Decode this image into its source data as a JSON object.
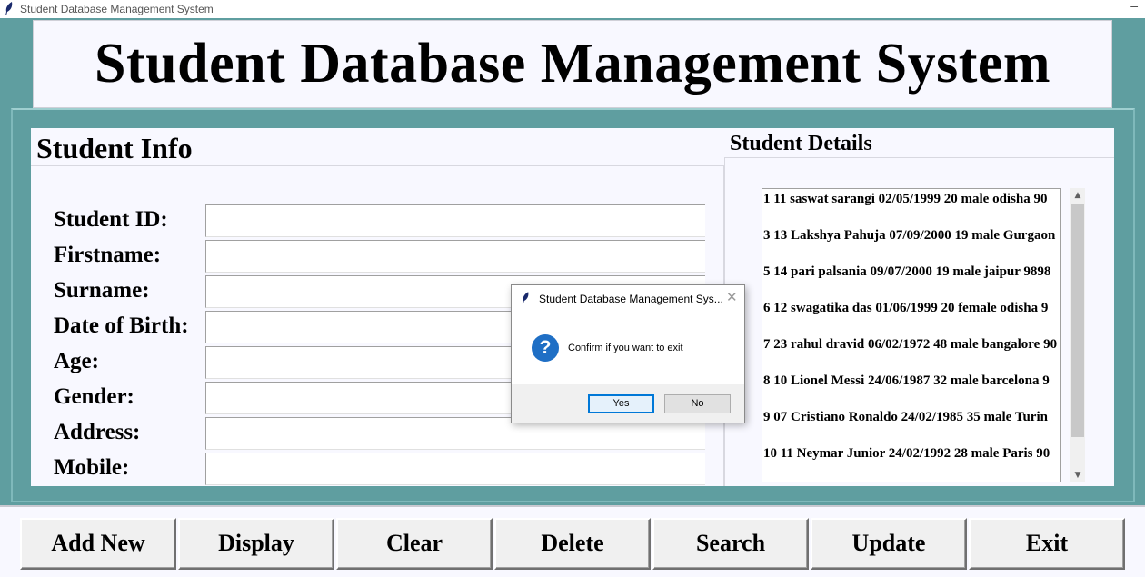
{
  "window": {
    "title": "Student Database Management System"
  },
  "header": {
    "title": "Student Database Management System"
  },
  "student_info": {
    "heading": "Student Info",
    "fields": [
      {
        "label": "Student ID:",
        "value": ""
      },
      {
        "label": "Firstname:",
        "value": ""
      },
      {
        "label": "Surname:",
        "value": ""
      },
      {
        "label": "Date of Birth:",
        "value": ""
      },
      {
        "label": "Age:",
        "value": ""
      },
      {
        "label": "Gender:",
        "value": ""
      },
      {
        "label": "Address:",
        "value": ""
      },
      {
        "label": "Mobile:",
        "value": ""
      }
    ]
  },
  "student_details": {
    "heading": "Student Details",
    "records": [
      "1 11 saswat sarangi 02/05/1999 20 male odisha 90",
      "3 13 Lakshya Pahuja 07/09/2000 19 male Gurgaon",
      "5 14 pari palsania 09/07/2000 19 male jaipur 9898",
      "6 12 swagatika das 01/06/1999 20 female odisha 9",
      "7 23 rahul dravid 06/02/1972 48 male bangalore 90",
      "8 10 Lionel Messi 24/06/1987 32 male barcelona 9",
      "9 07 Cristiano Ronaldo 24/02/1985 35 male Turin",
      "10 11 Neymar Junior 24/02/1992 28 male Paris 90"
    ]
  },
  "buttons": {
    "add_new": "Add New",
    "display": "Display",
    "clear": "Clear",
    "delete": "Delete",
    "search": "Search",
    "update": "Update",
    "exit": "Exit"
  },
  "dialog": {
    "title": "Student Database Management Sys...",
    "message": "Confirm if you want to exit",
    "yes": "Yes",
    "no": "No",
    "icon": "question-icon",
    "icon_color": "#1f6fc5"
  },
  "colors": {
    "background": "#5f9ea0",
    "panel": "#f8f8ff"
  }
}
